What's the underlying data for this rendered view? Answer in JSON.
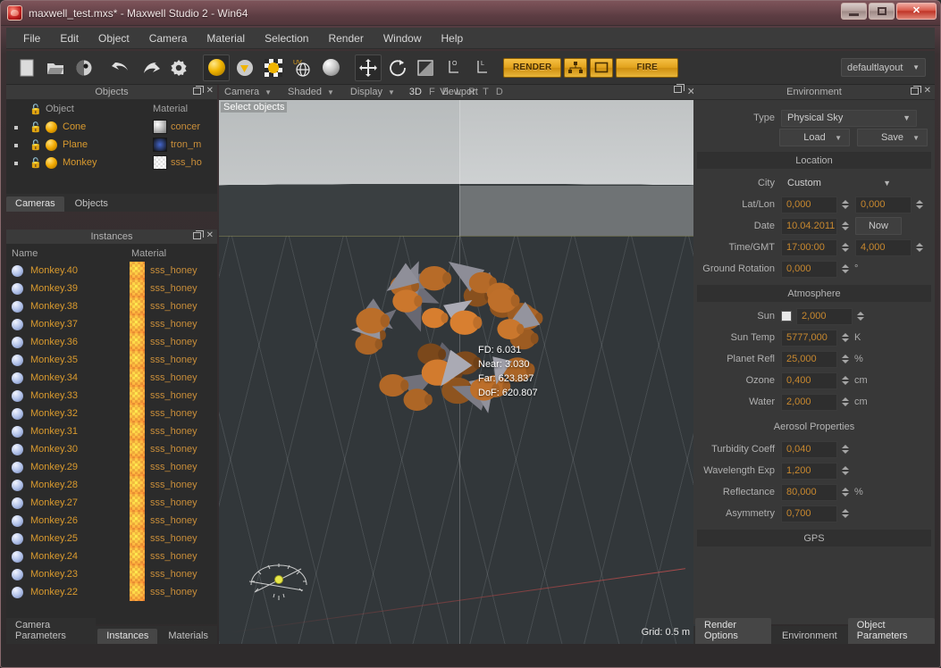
{
  "window": {
    "title": "maxwell_test.mxs* - Maxwell Studio 2 -  Win64",
    "icon": "app-icon",
    "minimize": "–",
    "maximize": "□",
    "close": "✕"
  },
  "menu": [
    "File",
    "Edit",
    "Object",
    "Camera",
    "Material",
    "Selection",
    "Render",
    "Window",
    "Help"
  ],
  "toolbar": {
    "icons": [
      "new-document-icon",
      "open-folder-icon",
      "save-scene-icon",
      "undo-icon",
      "redo-icon",
      "settings-gear-icon",
      "material-gold-sphere-icon",
      "material-preview-icon",
      "material-texture-icon",
      "uv-mapping-icon",
      "material-picker-icon",
      "move-tool-icon",
      "rotate-tool-icon",
      "scale-tool-icon",
      "object-origin-icon",
      "local-axis-icon"
    ],
    "render_label": "RENDER",
    "network_render_icon": "network-render-icon",
    "region_render_icon": "region-render-icon",
    "fire_label": "FIRE",
    "layout_value": "defaultlayout"
  },
  "objects_panel": {
    "title": "Objects",
    "float_icon": "float-panel-icon",
    "close_icon": "close-panel-icon",
    "headers": {
      "object": "Object",
      "material": "Material"
    },
    "rows": [
      {
        "name": "Cone",
        "material": "concer"
      },
      {
        "name": "Plane",
        "material": "tron_m"
      },
      {
        "name": "Monkey",
        "material": "sss_ho"
      }
    ],
    "tabs": [
      {
        "label": "Cameras",
        "selected": true
      },
      {
        "label": "Objects",
        "selected": false
      }
    ]
  },
  "instances_panel": {
    "title": "Instances",
    "float_icon": "float-panel-icon",
    "close_icon": "close-panel-icon",
    "headers": {
      "name": "Name",
      "material": "Material"
    },
    "rows": [
      {
        "name": "Monkey.40",
        "material": "sss_honey"
      },
      {
        "name": "Monkey.39",
        "material": "sss_honey"
      },
      {
        "name": "Monkey.38",
        "material": "sss_honey"
      },
      {
        "name": "Monkey.37",
        "material": "sss_honey"
      },
      {
        "name": "Monkey.36",
        "material": "sss_honey"
      },
      {
        "name": "Monkey.35",
        "material": "sss_honey"
      },
      {
        "name": "Monkey.34",
        "material": "sss_honey"
      },
      {
        "name": "Monkey.33",
        "material": "sss_honey"
      },
      {
        "name": "Monkey.32",
        "material": "sss_honey"
      },
      {
        "name": "Monkey.31",
        "material": "sss_honey"
      },
      {
        "name": "Monkey.30",
        "material": "sss_honey"
      },
      {
        "name": "Monkey.29",
        "material": "sss_honey"
      },
      {
        "name": "Monkey.28",
        "material": "sss_honey"
      },
      {
        "name": "Monkey.27",
        "material": "sss_honey"
      },
      {
        "name": "Monkey.26",
        "material": "sss_honey"
      },
      {
        "name": "Monkey.25",
        "material": "sss_honey"
      },
      {
        "name": "Monkey.24",
        "material": "sss_honey"
      },
      {
        "name": "Monkey.23",
        "material": "sss_honey"
      },
      {
        "name": "Monkey.22",
        "material": "sss_honey"
      }
    ],
    "tabs": [
      {
        "label": "Camera Parameters",
        "selected": false
      },
      {
        "label": "Instances",
        "selected": true
      },
      {
        "label": "Materials",
        "selected": false
      }
    ]
  },
  "viewport": {
    "header": {
      "camera": "Camera",
      "shading": "Shaded",
      "display": "Display",
      "axes": [
        "3D",
        "F",
        "B",
        "L",
        "R",
        "T",
        "D"
      ],
      "title": "Viewport",
      "float_icon": "float-panel-icon",
      "close_icon": "close-panel-icon"
    },
    "status": "Select objects",
    "camera_info": {
      "fd": "FD: 6.031",
      "near": "Near: 3.030",
      "far": "Far: 623.837",
      "dof": "DoF: 620.807"
    },
    "grid_label": "Grid: 0.5 m",
    "gizmo_icon": "axis-gizmo-icon"
  },
  "environment": {
    "title": "Environment",
    "float_icon": "float-panel-icon",
    "close_icon": "close-panel-icon",
    "type_label": "Type",
    "type_value": "Physical Sky",
    "load_label": "Load",
    "save_label": "Save",
    "location": {
      "heading": "Location",
      "city_label": "City",
      "city_value": "Custom",
      "latlon_label": "Lat/Lon",
      "lat_value": "0,000",
      "lon_value": "0,000",
      "date_label": "Date",
      "date_value": "10.04.2011",
      "now_label": "Now",
      "time_label": "Time/GMT",
      "time_value": "17:00:00",
      "gmt_value": "4,000",
      "ground_rotation_label": "Ground Rotation",
      "ground_rotation_value": "0,000",
      "ground_rotation_unit": "°"
    },
    "atmosphere": {
      "heading": "Atmosphere",
      "sun_label": "Sun",
      "sun_color": "#e9e9e9",
      "sun_value": "2,000",
      "sun_temp_label": "Sun Temp",
      "sun_temp_value": "5777,000",
      "sun_temp_unit": "K",
      "planet_refl_label": "Planet Refl",
      "planet_refl_value": "25,000",
      "planet_refl_unit": "%",
      "ozone_label": "Ozone",
      "ozone_value": "0,400",
      "ozone_unit": "cm",
      "water_label": "Water",
      "water_value": "2,000",
      "water_unit": "cm"
    },
    "aerosol": {
      "heading": "Aerosol Properties",
      "turbidity_label": "Turbidity Coeff",
      "turbidity_value": "0,040",
      "wavelength_label": "Wavelength Exp",
      "wavelength_value": "1,200",
      "reflectance_label": "Reflectance",
      "reflectance_value": "80,000",
      "reflectance_unit": "%",
      "asymmetry_label": "Asymmetry",
      "asymmetry_value": "0,700"
    },
    "gps_heading": "GPS",
    "tabs": [
      {
        "label": "Render Options",
        "selected": false
      },
      {
        "label": "Environment",
        "selected": true
      },
      {
        "label": "Object Parameters",
        "selected": false
      }
    ]
  },
  "colors": {
    "accent_amber": "#e2a21c",
    "text_orange": "#d99a2e",
    "panel_bg": "#383838",
    "titlebar": "#6a464c"
  }
}
